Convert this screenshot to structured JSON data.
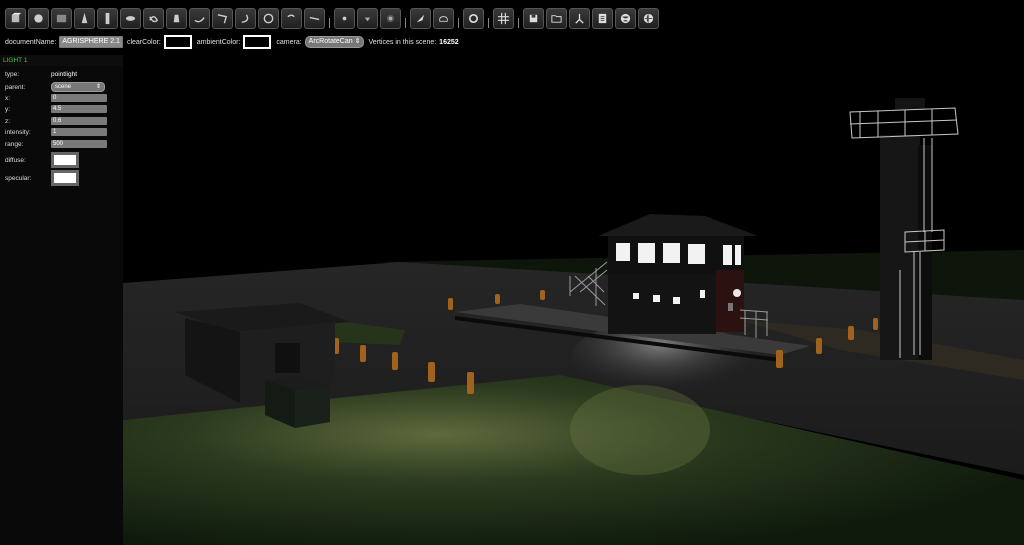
{
  "toolbar": {
    "groups": [
      [
        "cube-icon",
        "sphere-icon",
        "plane-icon",
        "cone-icon",
        "cylinder-icon",
        "disc-icon",
        "knot-icon",
        "teapot-icon",
        "curve-icon",
        "arrow-icon",
        "arc-icon",
        "circle-icon",
        "spiral-icon",
        "line-icon"
      ],
      [
        "dot-light-icon",
        "spot-light-icon",
        "ambient-light-icon"
      ],
      [
        "brush-icon",
        "cloud-icon"
      ],
      [
        "refresh-icon"
      ],
      [
        "grid-icon"
      ],
      [
        "save-icon",
        "folder-icon",
        "share-icon",
        "document-icon",
        "globe-icon",
        "world-icon"
      ]
    ]
  },
  "docbar": {
    "document_name_label": "documentName:",
    "document_name_value": "AGRISPHERE 2.1",
    "clear_color_label": "clearColor:",
    "ambient_color_label": "ambientColor:",
    "camera_label": "camera:",
    "camera_value": "ArcRotateCan",
    "vertices_label": "Vertices in this scene:",
    "vertices_value": "16252"
  },
  "panel": {
    "title": "LIGHT 1",
    "type_label": "type:",
    "type_value": "pointlight",
    "parent_label": "parent:",
    "parent_value": "scene",
    "x_label": "x:",
    "x_value": "0",
    "y_label": "y:",
    "y_value": "4.5",
    "z_label": "z:",
    "z_value": "0.6",
    "intensity_label": "intensity:",
    "intensity_value": "1",
    "range_label": "range:",
    "range_value": "500",
    "diffuse_label": "diffuse:",
    "specular_label": "specular:"
  },
  "colors": {
    "clear_color": "#000000",
    "ambient_color": "#000000",
    "diffuse": "#ffffff",
    "specular": "#ffffff",
    "panel_title": "#44cc44"
  }
}
